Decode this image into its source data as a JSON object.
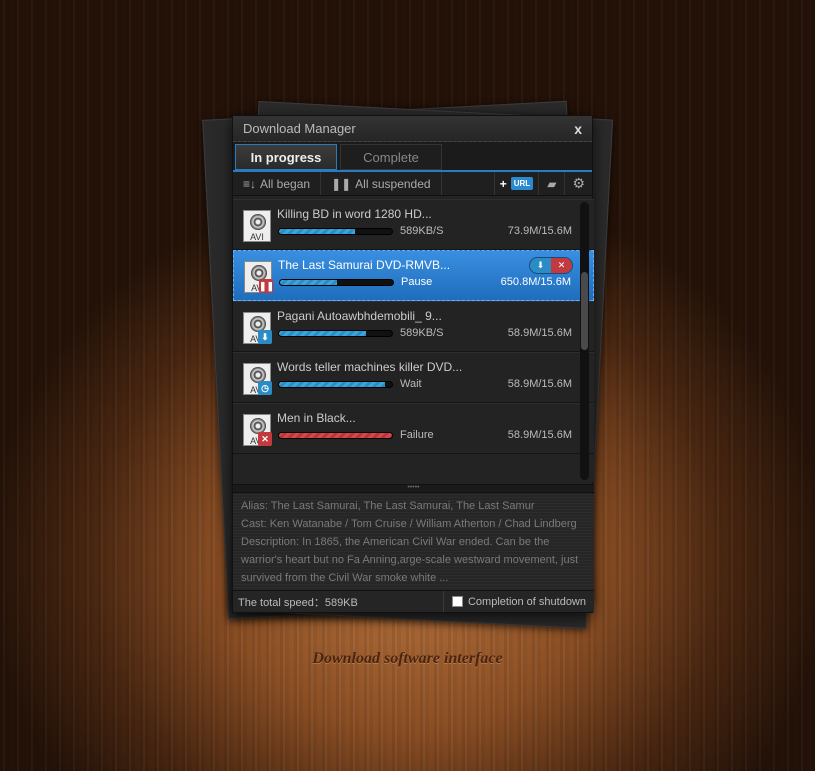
{
  "window": {
    "title": "Download Manager",
    "close": "x"
  },
  "tabs": [
    {
      "label": "In progress",
      "active": true
    },
    {
      "label": "Complete",
      "active": false
    }
  ],
  "toolbar": {
    "all_began": "All began",
    "all_suspended": "All suspended",
    "url": "URL"
  },
  "downloads": [
    {
      "name": "Killing BD in word 1280 HD...",
      "type": "AVI",
      "status": "589KB/S",
      "size": "73.9M/15.6M",
      "progress": 0.67,
      "badge": ""
    },
    {
      "name": "The Last Samurai DVD-RMVB...",
      "type": "AVI",
      "status": "Pause",
      "size": "650.8M/15.6M",
      "progress": 0.5,
      "badge": "pause",
      "selected": true
    },
    {
      "name": "Pagani Autoawbhdemobili_ 9...",
      "type": "AVI",
      "status": "589KB/S",
      "size": "58.9M/15.6M",
      "progress": 0.77,
      "badge": "download"
    },
    {
      "name": "Words teller machines killer DVD...",
      "type": "AVI",
      "status": "Wait",
      "size": "58.9M/15.6M",
      "progress": 0.94,
      "badge": "clock"
    },
    {
      "name": "Men in Black...",
      "type": "AVI",
      "status": "Failure",
      "size": "58.9M/15.6M",
      "progress": 1.0,
      "badge": "error"
    }
  ],
  "info": {
    "alias": "Alias: The Last Samurai, The Last Samurai, The Last Samur",
    "cast": "Cast: Ken Watanabe / Tom Cruise / William Atherton / Chad Lindberg",
    "description": "Description: In 1865, the American Civil War ended. Can be the warrior's heart but no Fa Anning,arge-scale westward movement, just survived from the Civil War smoke white ..."
  },
  "status": {
    "total_speed": "The total speed：589KB",
    "shutdown_label": "Completion of shutdown",
    "shutdown_checked": false
  },
  "caption": "Download software interface",
  "colors": {
    "accent": "#2b7bc4",
    "failure": "#c23a3e"
  }
}
